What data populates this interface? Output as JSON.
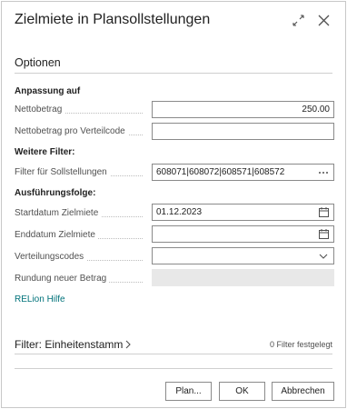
{
  "dialog": {
    "title": "Zielmiete in Plansollstellungen"
  },
  "options": {
    "heading": "Optionen",
    "group_adjustment": "Anpassung auf",
    "net_amount_label": "Nettobetrag",
    "net_amount_value": "250.00",
    "net_amount_dist_label": "Nettobetrag pro Verteilcode",
    "net_amount_dist_value": "",
    "group_filters": "Weitere Filter:",
    "filter_postings_label": "Filter für Sollstellungen",
    "filter_postings_value": "608071|608072|608571|608572",
    "group_sequence": "Ausführungsfolge:",
    "start_date_label": "Startdatum Zielmiete",
    "start_date_value": "01.12.2023",
    "end_date_label": "Enddatum Zielmiete",
    "end_date_value": "",
    "dist_codes_label": "Verteilungscodes",
    "dist_codes_value": "",
    "rounding_label": "Rundung neuer Betrag",
    "rounding_value": "",
    "help_link": "RELion Hilfe"
  },
  "filter_section": {
    "title": "Filter: Einheitenstamm",
    "count": "0 Filter festgelegt"
  },
  "buttons": {
    "plan": "Plan...",
    "ok": "OK",
    "cancel": "Abbrechen"
  }
}
